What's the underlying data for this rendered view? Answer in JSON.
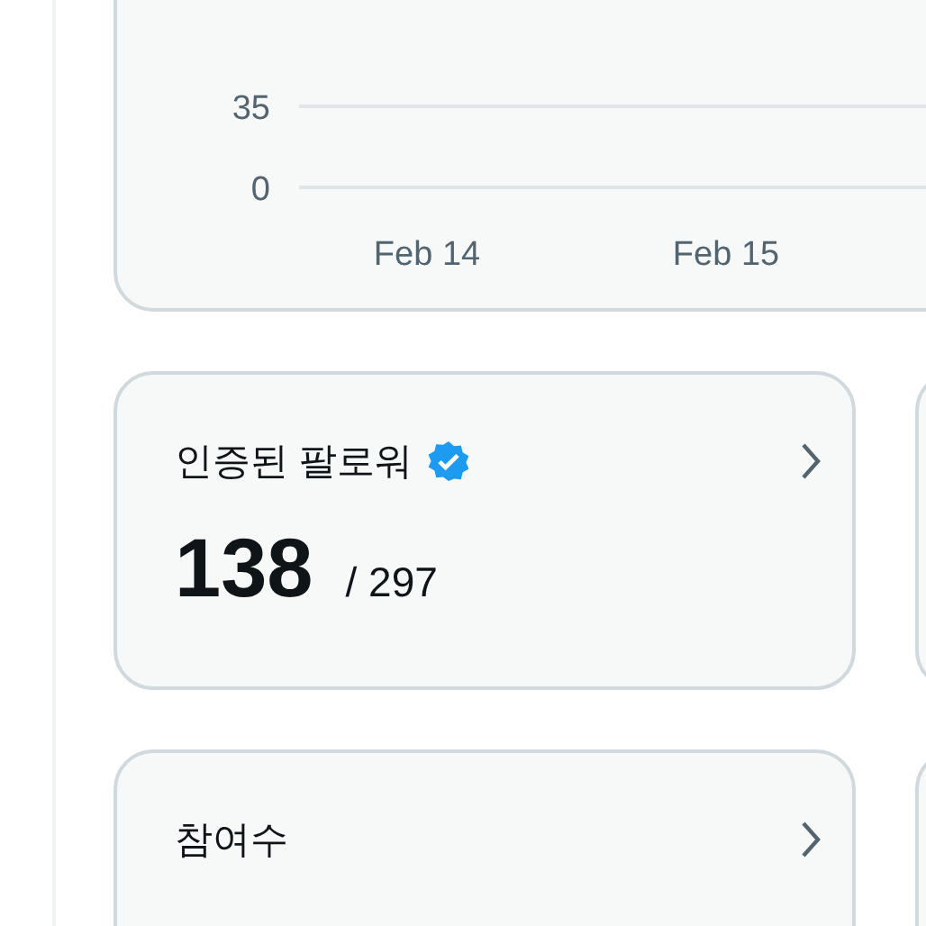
{
  "engagement_chart": {
    "chart_data": {
      "type": "line",
      "categories": [
        "Feb 14",
        "Feb 15"
      ],
      "yticks": [
        0,
        35
      ],
      "ylim": [
        0,
        35
      ]
    }
  },
  "verified_followers": {
    "title": "인증된 팔로워",
    "value": "138",
    "total": "/ 297"
  },
  "engagements": {
    "title": "참여수"
  }
}
